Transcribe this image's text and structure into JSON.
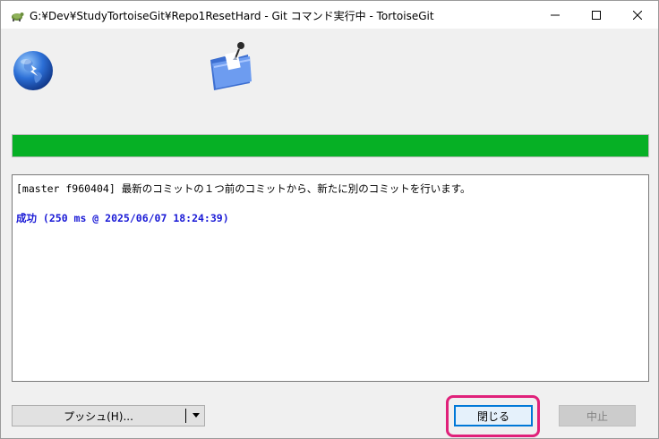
{
  "window": {
    "title": "G:¥Dev¥StudyTortoiseGit¥Repo1ResetHard - Git コマンド実行中 - TortoiseGit"
  },
  "progress": {
    "value": 1.0,
    "color": "#06b025"
  },
  "log": {
    "line1": "[master f960404] 最新のコミットの１つ前のコミットから、新たに別のコミットを行います。",
    "line2": "成功 (250 ms @ 2025/06/07 18:24:39)"
  },
  "buttons": {
    "push_label": "プッシュ(H)...",
    "close_label": "閉じる",
    "abort_label": "中止"
  },
  "icons": {
    "app": "tortoisegit-icon",
    "globe": "globe-icon",
    "folder": "folder-icon"
  },
  "colors": {
    "accent": "#0078d7",
    "highlight": "#e0217a",
    "success_text": "#1a1ad6"
  }
}
